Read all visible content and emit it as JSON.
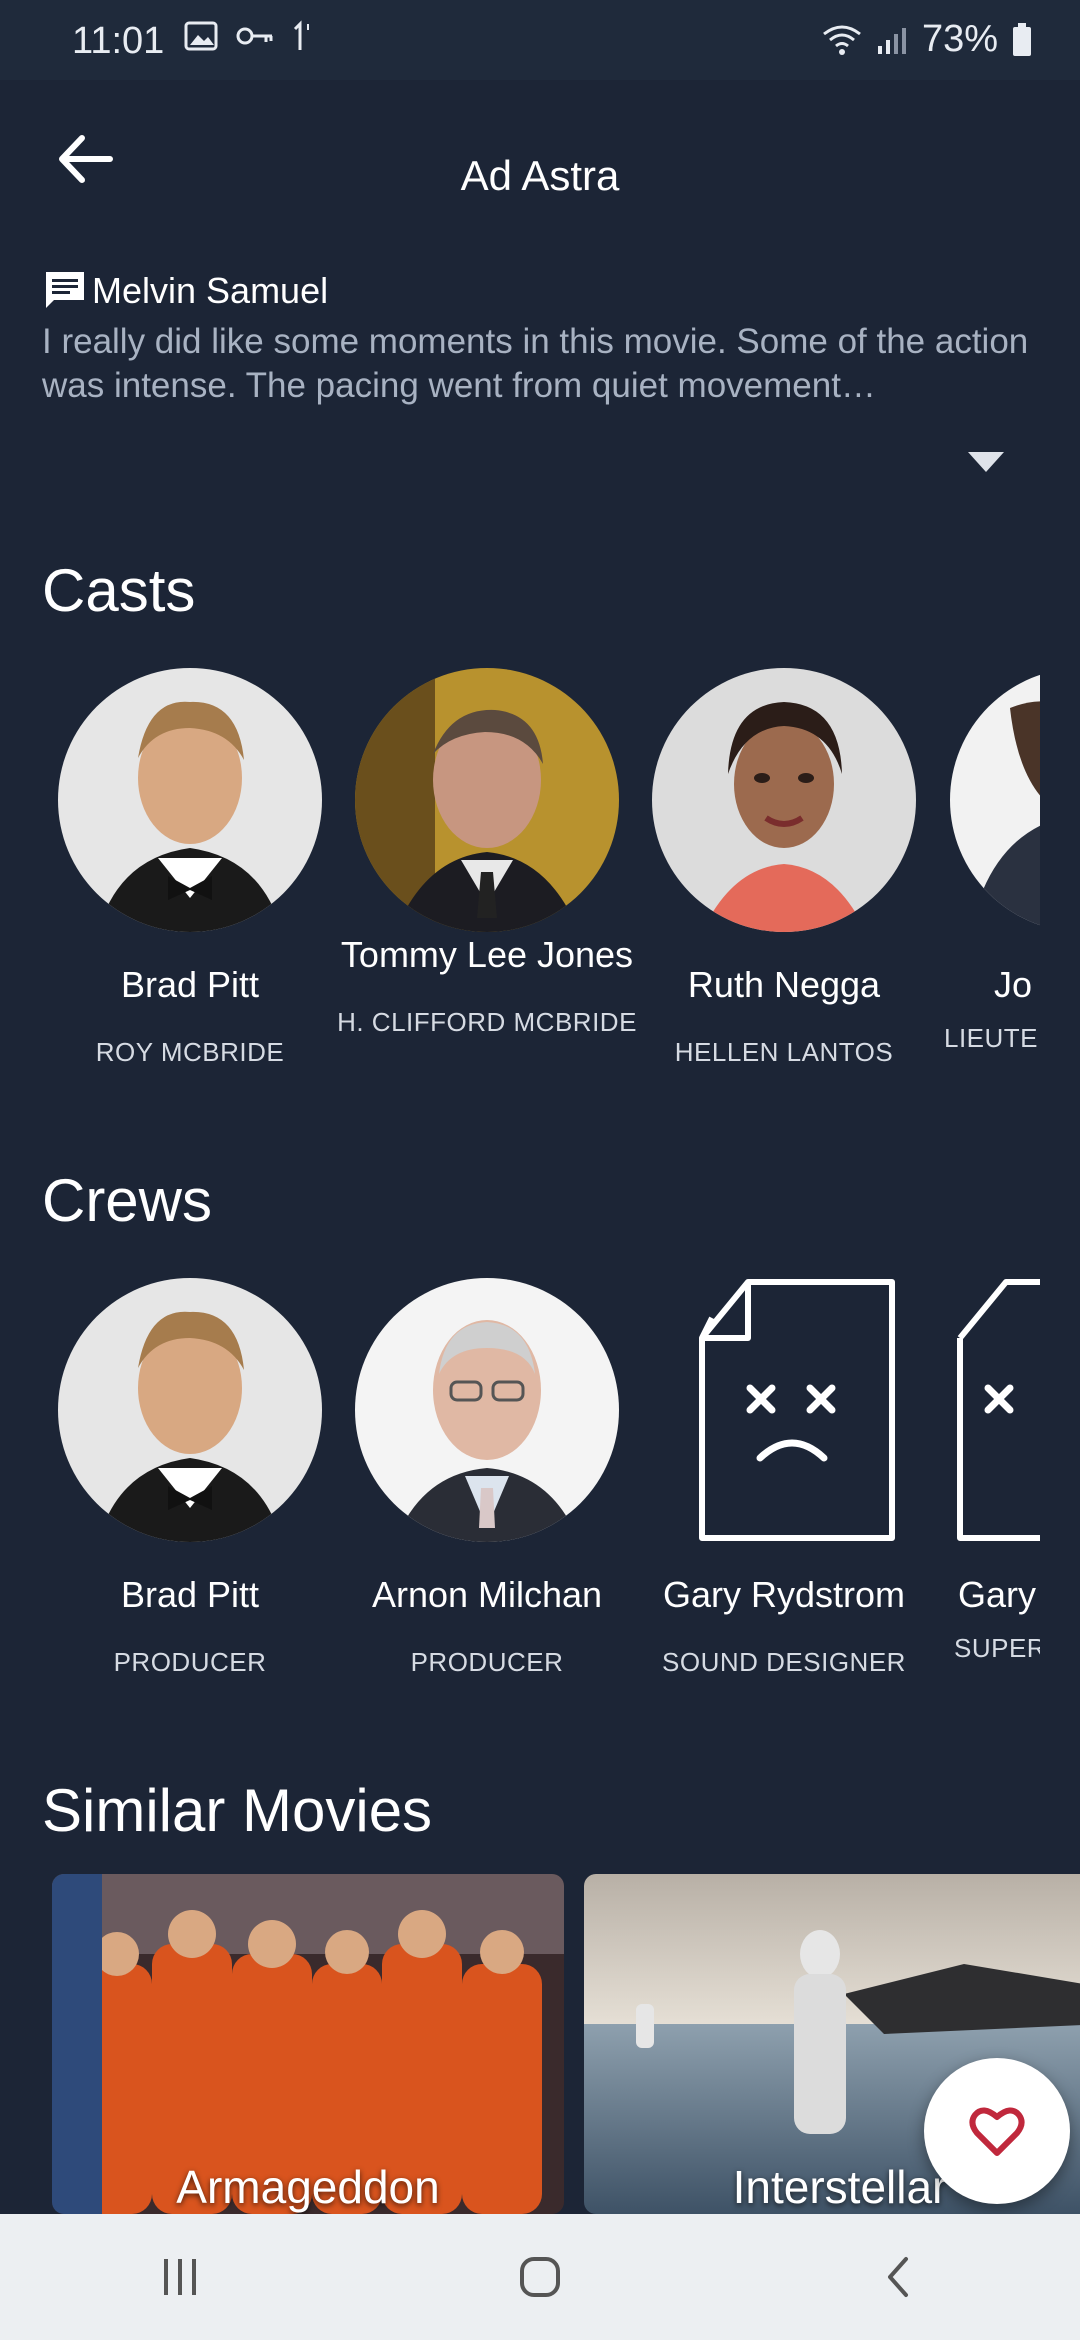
{
  "status": {
    "time": "11:01",
    "battery": "73%",
    "left_icons": [
      "image-icon",
      "key-icon",
      "data-icon"
    ],
    "right_icons": [
      "wifi-icon",
      "signal-icon",
      "battery-icon"
    ]
  },
  "header": {
    "title": "Ad Astra",
    "back_icon": "back-arrow-icon"
  },
  "review": {
    "author": "Melvin Samuel",
    "text": "I really did like some moments in this movie. Some of the action was intense. The pacing went from quiet movement…"
  },
  "casts": {
    "title": "Casts",
    "items": [
      {
        "name": "Brad Pitt",
        "role": "ROY MCBRIDE"
      },
      {
        "name": "Tommy Lee Jones",
        "role": "H. CLIFFORD MCBRIDE"
      },
      {
        "name": "Ruth Negga",
        "role": "HELLEN LANTOS"
      },
      {
        "name": "Jo",
        "role": "LIEUTEN"
      }
    ]
  },
  "crews": {
    "title": "Crews",
    "items": [
      {
        "name": "Brad Pitt",
        "role": "PRODUCER"
      },
      {
        "name": "Arnon Milchan",
        "role": "PRODUCER"
      },
      {
        "name": "Gary Rydstrom",
        "role": "SOUND DESIGNER"
      },
      {
        "name": "Gary",
        "role": "SUPERV"
      }
    ]
  },
  "similar": {
    "title": "Similar Movies",
    "items": [
      {
        "title": "Armageddon"
      },
      {
        "title": "Interstellar"
      }
    ]
  },
  "colors": {
    "background": "#1c2536",
    "fab_heart": "#c0283c"
  }
}
